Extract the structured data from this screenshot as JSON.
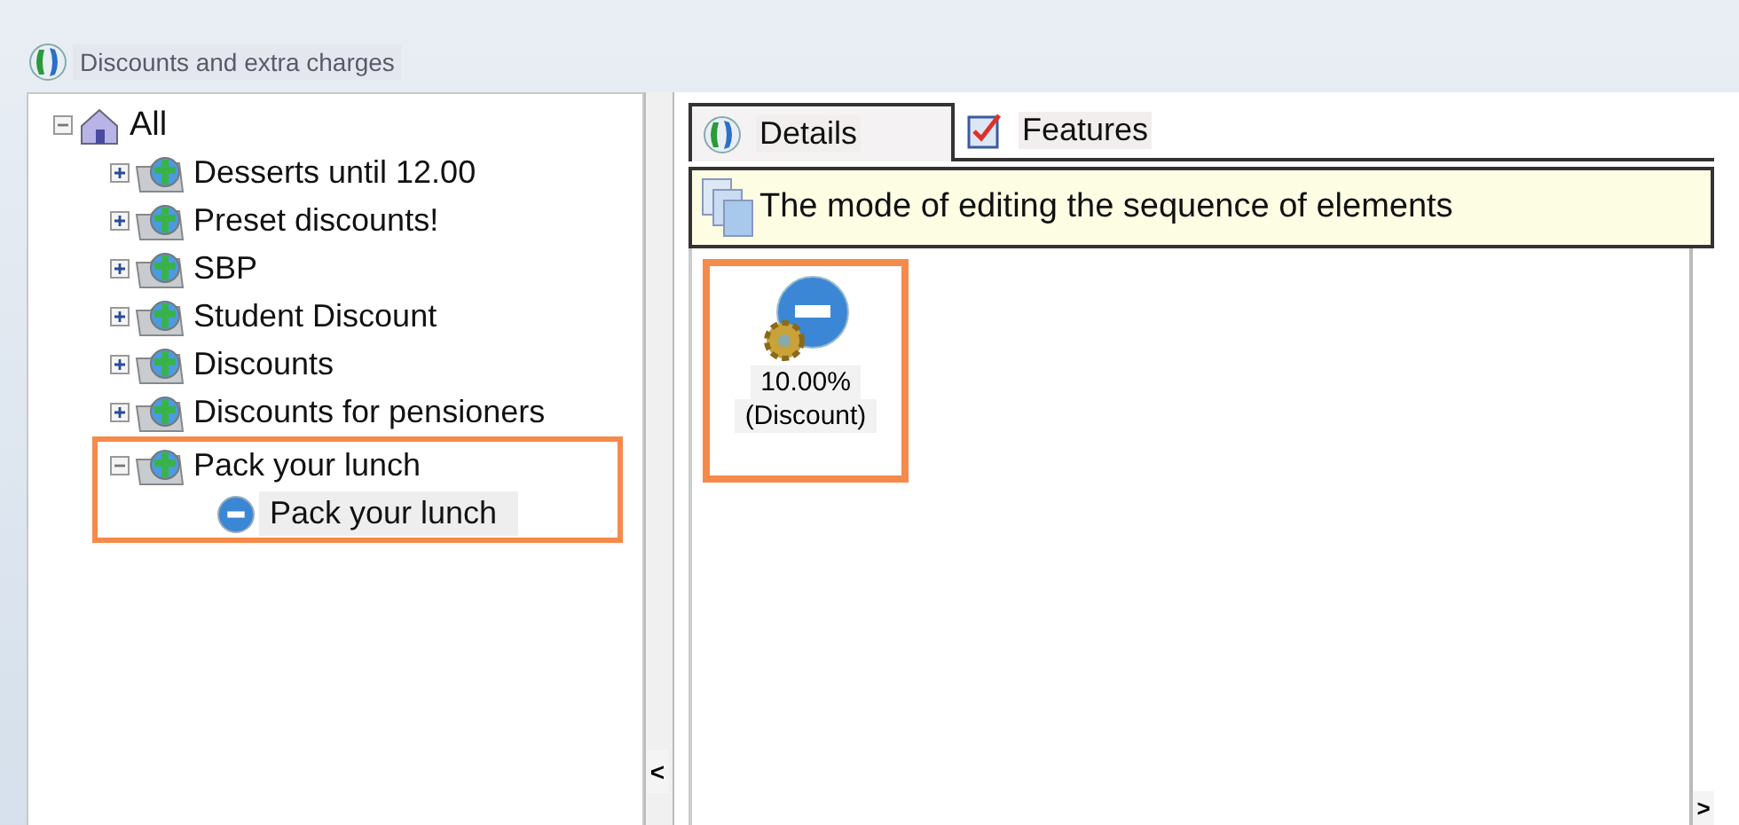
{
  "window": {
    "title": "Discounts and extra charges"
  },
  "tree": {
    "label": "All",
    "expanded": true,
    "children": [
      {
        "label": "Desserts until 12.00",
        "expanded": false,
        "highlighted": false
      },
      {
        "label": "Preset discounts!",
        "expanded": false,
        "highlighted": false
      },
      {
        "label": "SBP",
        "expanded": false,
        "highlighted": false
      },
      {
        "label": "Student Discount",
        "expanded": false,
        "highlighted": false
      },
      {
        "label": "Discounts",
        "expanded": false,
        "highlighted": false
      },
      {
        "label": "Discounts for pensioners",
        "expanded": false,
        "highlighted": false
      },
      {
        "label": "Pack your lunch",
        "expanded": true,
        "highlighted": true,
        "children": [
          {
            "label": "Pack your lunch",
            "selected": true
          }
        ]
      }
    ]
  },
  "splitter": {
    "arrow": "<"
  },
  "tabs": [
    {
      "label": "Details",
      "selected": true,
      "kind": "details"
    },
    {
      "label": "Features",
      "selected": false,
      "kind": "features"
    }
  ],
  "info_bar": {
    "text": "The mode of editing the sequence of elements"
  },
  "tiles": [
    {
      "value": "10.00%",
      "type": "(Discount)",
      "highlighted": true
    }
  ],
  "scroll_arrow": ">"
}
